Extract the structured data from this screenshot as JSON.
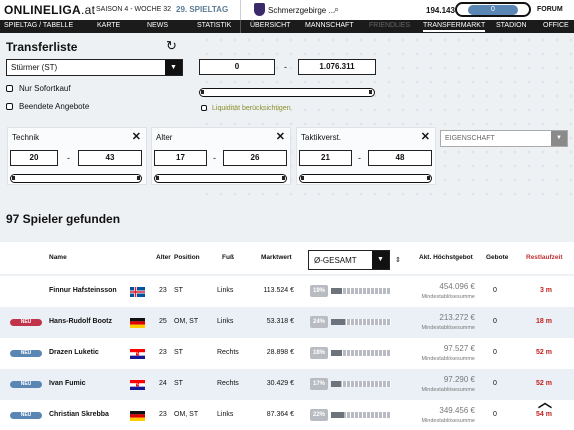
{
  "header": {
    "logo_bold": "ONLINE",
    "logo_bold2": "LIGA",
    "logo_suffix": ".at",
    "season": "SAISON 4 - WOCHE 32",
    "matchday": "29. SPIELTAG",
    "club_name": "Schmerzgebirge ...",
    "budget": "194.143 €",
    "messages": "0",
    "forum": "FORUM"
  },
  "nav": {
    "left": [
      "SPIELTAG / TABELLE",
      "KARTE",
      "NEWS",
      "STATISTIK"
    ],
    "right": [
      "ÜBERSICHT",
      "MANNSCHAFT",
      "FRIENDLIES",
      "TRANSFERMARKT",
      "STADION",
      "OFFICE"
    ],
    "active": "TRANSFERMARKT",
    "disabled": "FRIENDLIES"
  },
  "filters": {
    "title": "Transferliste",
    "position": "Stürmer (ST)",
    "only_instant_buy": "Nur Sofortkauf",
    "ended_offers": "Beendete Angebote",
    "price_min": "0",
    "price_max": "1.076.311",
    "liquidity": "Liquidität berücksichtigen",
    "boxes": [
      {
        "label": "Technik",
        "min": "20",
        "max": "43"
      },
      {
        "label": "Alter",
        "min": "17",
        "max": "26"
      },
      {
        "label": "Taktikverst.",
        "min": "21",
        "max": "48"
      }
    ],
    "property_placeholder": "EIGENSCHAFT"
  },
  "results": {
    "count_label": "97 Spieler gefunden"
  },
  "table": {
    "headers": {
      "name": "Name",
      "age": "Alter",
      "position": "Position",
      "foot": "Fuß",
      "market_value": "Marktwert",
      "highest_bid": "Akt. Höchstgebot",
      "offers": "Gebote",
      "remaining": "Restlaufzeit"
    },
    "sort_select": "Ø-GESAMT",
    "rows": [
      {
        "badge": "",
        "name": "Finnur Hafsteinsson",
        "flag": "is",
        "age": "23",
        "position": "ST",
        "foot": "Links",
        "value": "113.524 €",
        "pct": "19%",
        "pct_value": 19,
        "bid": "454.096 €",
        "bid_sub": "Mindestablösesumme",
        "offers": "0",
        "remaining": "3 m"
      },
      {
        "badge": "NEU",
        "badge_color": "#c0334b",
        "name": "Hans-Rudolf Bootz",
        "flag": "de",
        "age": "25",
        "position": "OM, ST",
        "foot": "Links",
        "value": "53.318 €",
        "pct": "24%",
        "pct_value": 24,
        "bid": "213.272 €",
        "bid_sub": "Mindestablösesumme",
        "offers": "0",
        "remaining": "18 m"
      },
      {
        "badge": "NEU",
        "badge_color": "#5a86b4",
        "name": "Drazen Luketic",
        "flag": "hr",
        "age": "23",
        "position": "ST",
        "foot": "Rechts",
        "value": "28.898 €",
        "pct": "18%",
        "pct_value": 18,
        "bid": "97.527 €",
        "bid_sub": "Mindestablösesumme",
        "offers": "0",
        "remaining": "52 m"
      },
      {
        "badge": "NEU",
        "badge_color": "#5a86b4",
        "name": "Ivan Fumic",
        "flag": "hr",
        "age": "24",
        "position": "ST",
        "foot": "Rechts",
        "value": "30.429 €",
        "pct": "17%",
        "pct_value": 17,
        "bid": "97.290 €",
        "bid_sub": "Mindestablösesumme",
        "offers": "0",
        "remaining": "52 m"
      },
      {
        "badge": "NEU",
        "badge_color": "#5a86b4",
        "name": "Christian Skrebba",
        "flag": "de",
        "age": "23",
        "position": "OM, ST",
        "foot": "Links",
        "value": "87.364 €",
        "pct": "22%",
        "pct_value": 22,
        "bid": "349.456 €",
        "bid_sub": "Mindestablösesumme",
        "offers": "0",
        "remaining": "54 m"
      }
    ]
  }
}
